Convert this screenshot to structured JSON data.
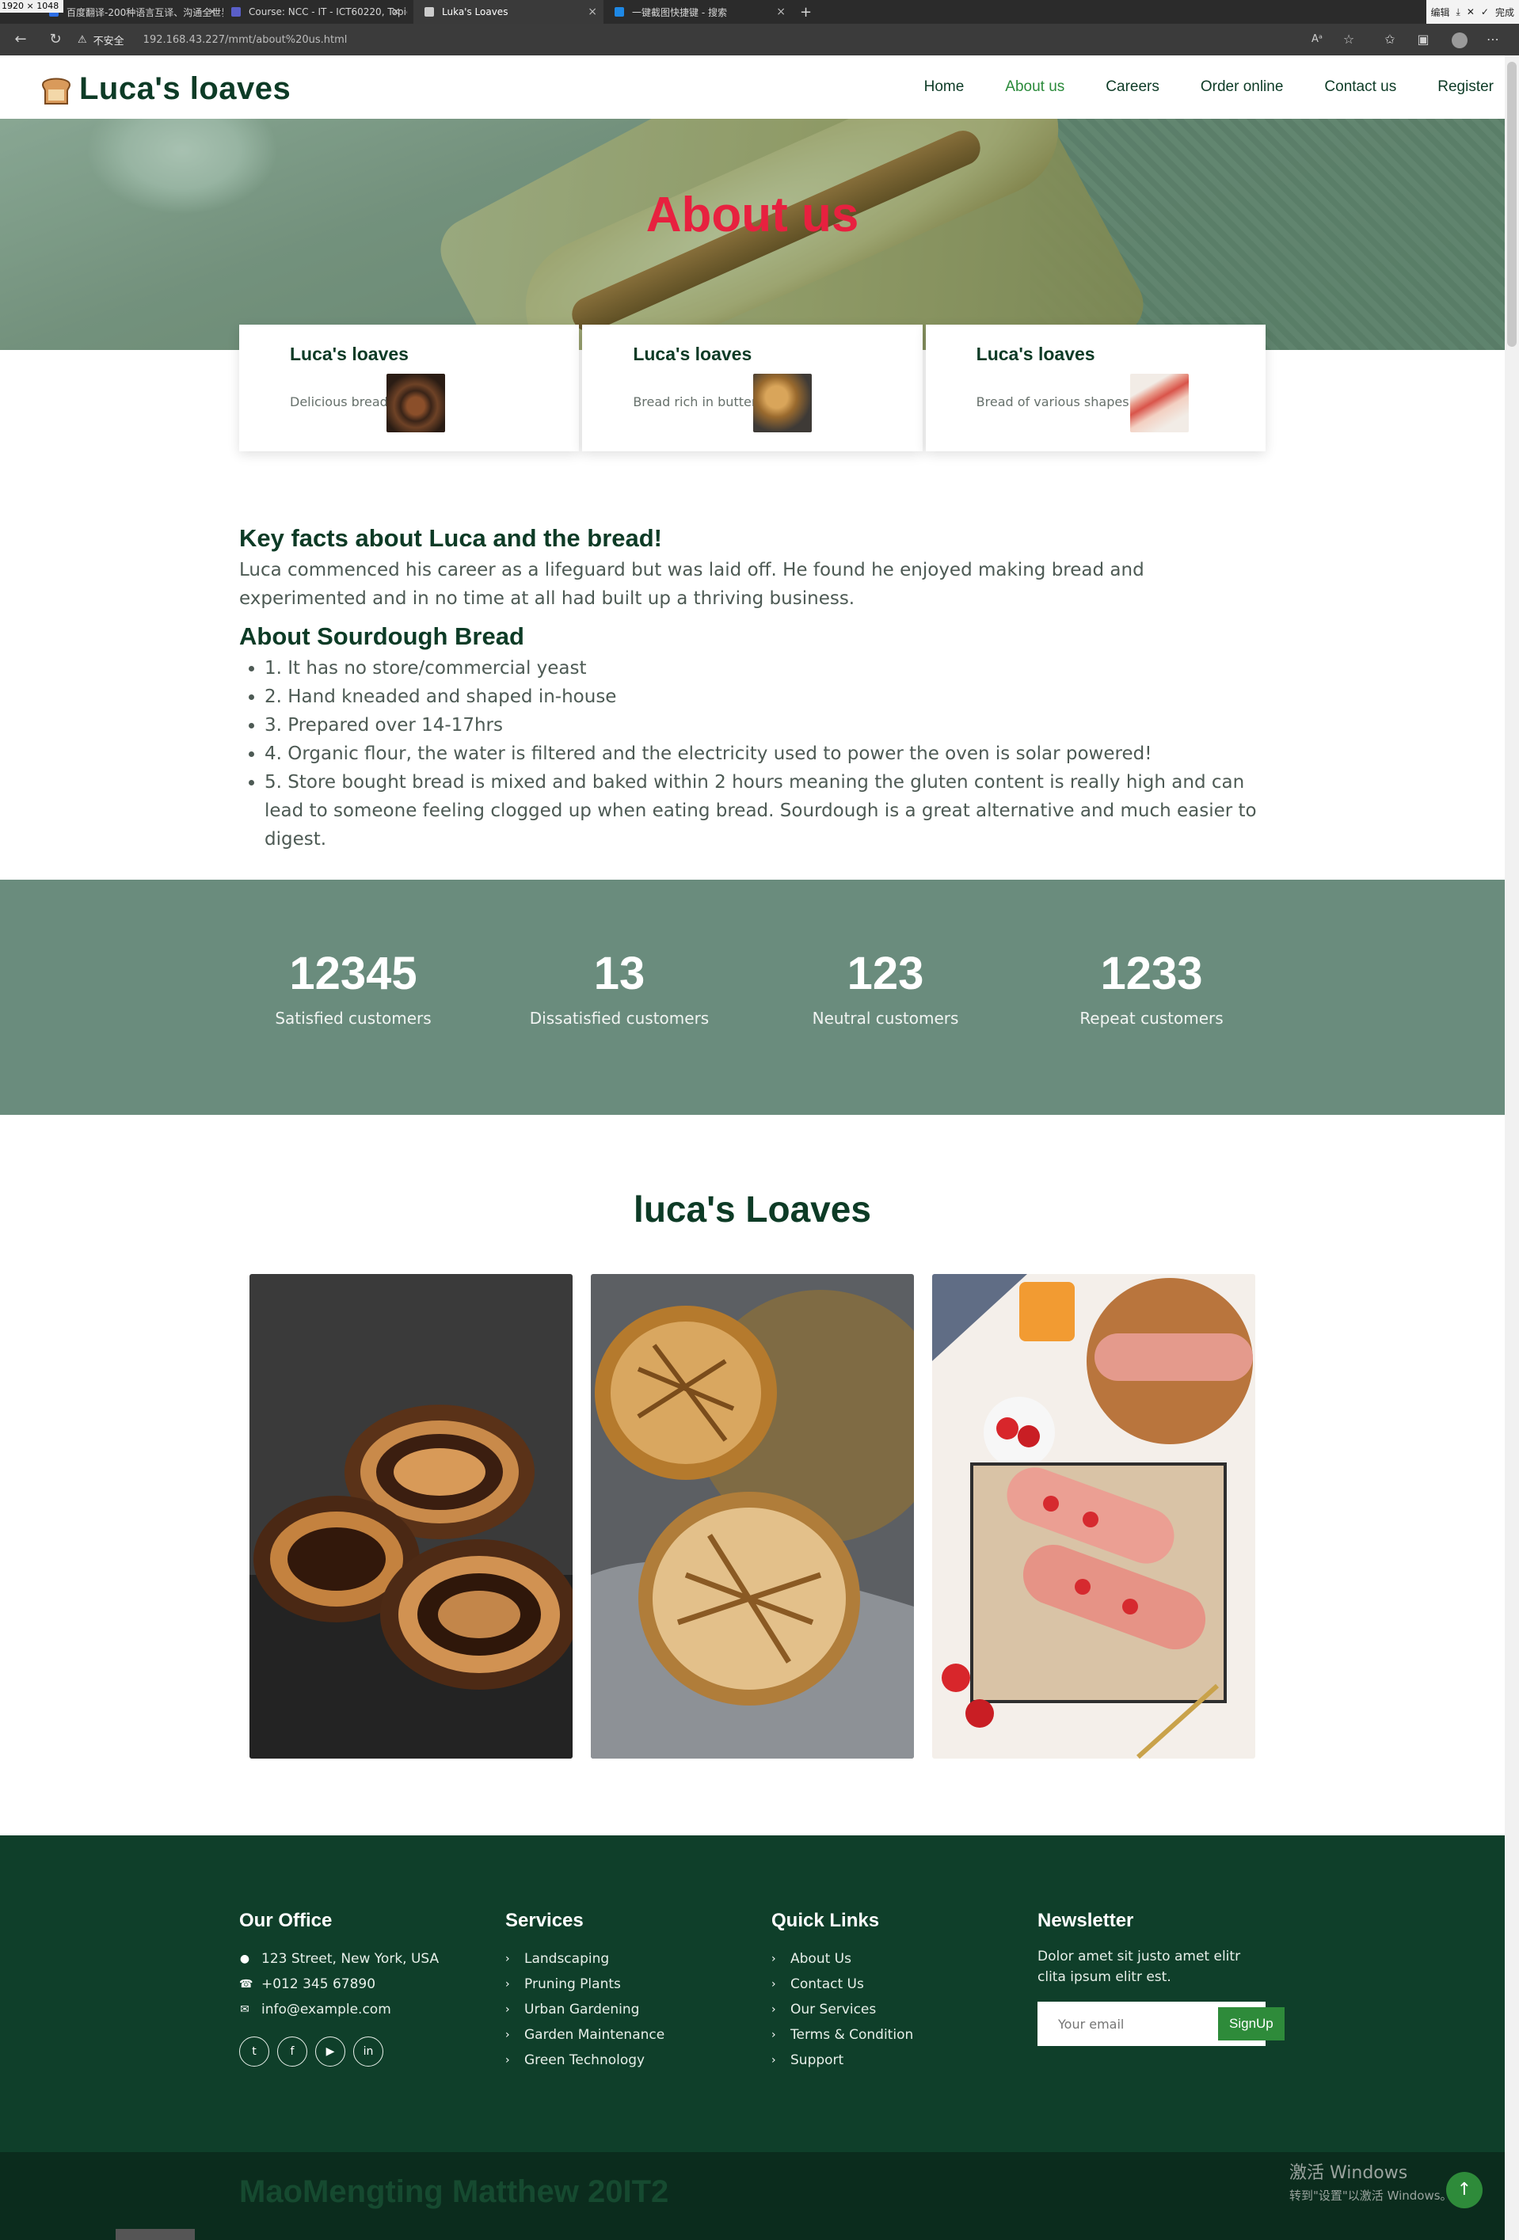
{
  "browser": {
    "resolution": "1920 × 1048",
    "tabs": [
      {
        "title": "百度翻译-200种语言互译、沟通全世界！",
        "active": false,
        "color": "#2d6ee6"
      },
      {
        "title": "Course: NCC - IT - ICT60220, Topic...",
        "active": false,
        "color": "#5a5fc9"
      },
      {
        "title": "Luka's Loaves",
        "active": true,
        "color": "#cccccc"
      },
      {
        "title": "一键截图快捷键 - 搜索",
        "active": false,
        "color": "#1e88e5"
      }
    ],
    "new_tab": "+",
    "top_tools": [
      "编辑",
      "完成"
    ],
    "insecure_label": "不安全",
    "url": "192.168.43.227/mmt/about%20us.html"
  },
  "header": {
    "logo_text": "Luca's loaves",
    "nav": [
      {
        "label": "Home",
        "active": false
      },
      {
        "label": "About us",
        "active": true
      },
      {
        "label": "Careers",
        "active": false
      },
      {
        "label": "Order online",
        "active": false
      },
      {
        "label": "Contact us",
        "active": false
      },
      {
        "label": "Register",
        "active": false
      }
    ]
  },
  "hero": {
    "title": "About us"
  },
  "cards": [
    {
      "title": "Luca's loaves",
      "desc": "Delicious bread"
    },
    {
      "title": "Luca's loaves",
      "desc": "Bread rich in butter"
    },
    {
      "title": "Luca's loaves",
      "desc": "Bread of various shapes"
    }
  ],
  "facts": {
    "heading": "Key facts about Luca and the bread!",
    "paragraph": "Luca commenced his career as a lifeguard but was laid off. He found he enjoyed making bread and experimented and in no time at all had built up a thriving business.",
    "sour_heading": "About Sourdough Bread",
    "items": [
      "1. It has no store/commercial yeast",
      "2. Hand kneaded and shaped in-house",
      "3. Prepared over 14-17hrs",
      "4. Organic flour, the water is filtered and the electricity used to power the oven is solar powered!",
      "5. Store bought bread is mixed and baked within 2 hours meaning the gluten content is really high and can lead to someone feeling clogged up when eating bread. Sourdough is a great alternative and much easier to digest."
    ]
  },
  "stats": [
    {
      "number": "12345",
      "label": "Satisfied customers"
    },
    {
      "number": "13",
      "label": "Dissatisfied customers"
    },
    {
      "number": "123",
      "label": "Neutral customers"
    },
    {
      "number": "1233",
      "label": "Repeat customers"
    }
  ],
  "gallery": {
    "title": "luca's Loaves"
  },
  "footer": {
    "office": {
      "heading": "Our Office",
      "address": "123 Street, New York, USA",
      "phone": "+012 345 67890",
      "email": "info@example.com",
      "social": [
        "twitter-icon",
        "facebook-icon",
        "youtube-icon",
        "linkedin-icon"
      ]
    },
    "services": {
      "heading": "Services",
      "items": [
        "Landscaping",
        "Pruning Plants",
        "Urban Gardening",
        "Garden Maintenance",
        "Green Technology"
      ]
    },
    "quick_links": {
      "heading": "Quick Links",
      "items": [
        "About Us",
        "Contact Us",
        "Our Services",
        "Terms & Condition",
        "Support"
      ]
    },
    "newsletter": {
      "heading": "Newsletter",
      "text": "Dolor amet sit justo amet elitr clita ipsum elitr est.",
      "placeholder": "Your email",
      "button": "SignUp"
    }
  },
  "copyright": "MaoMengting Matthew 20IT2",
  "windows_watermark": {
    "line1": "激活 Windows",
    "line2": "转到\"设置\"以激活 Windows。"
  },
  "colors": {
    "brand_dark": "#0d3b26",
    "accent_red": "#e7213f",
    "accent_green": "#2e8b3a",
    "stats_bg": "#6a8c7d"
  }
}
